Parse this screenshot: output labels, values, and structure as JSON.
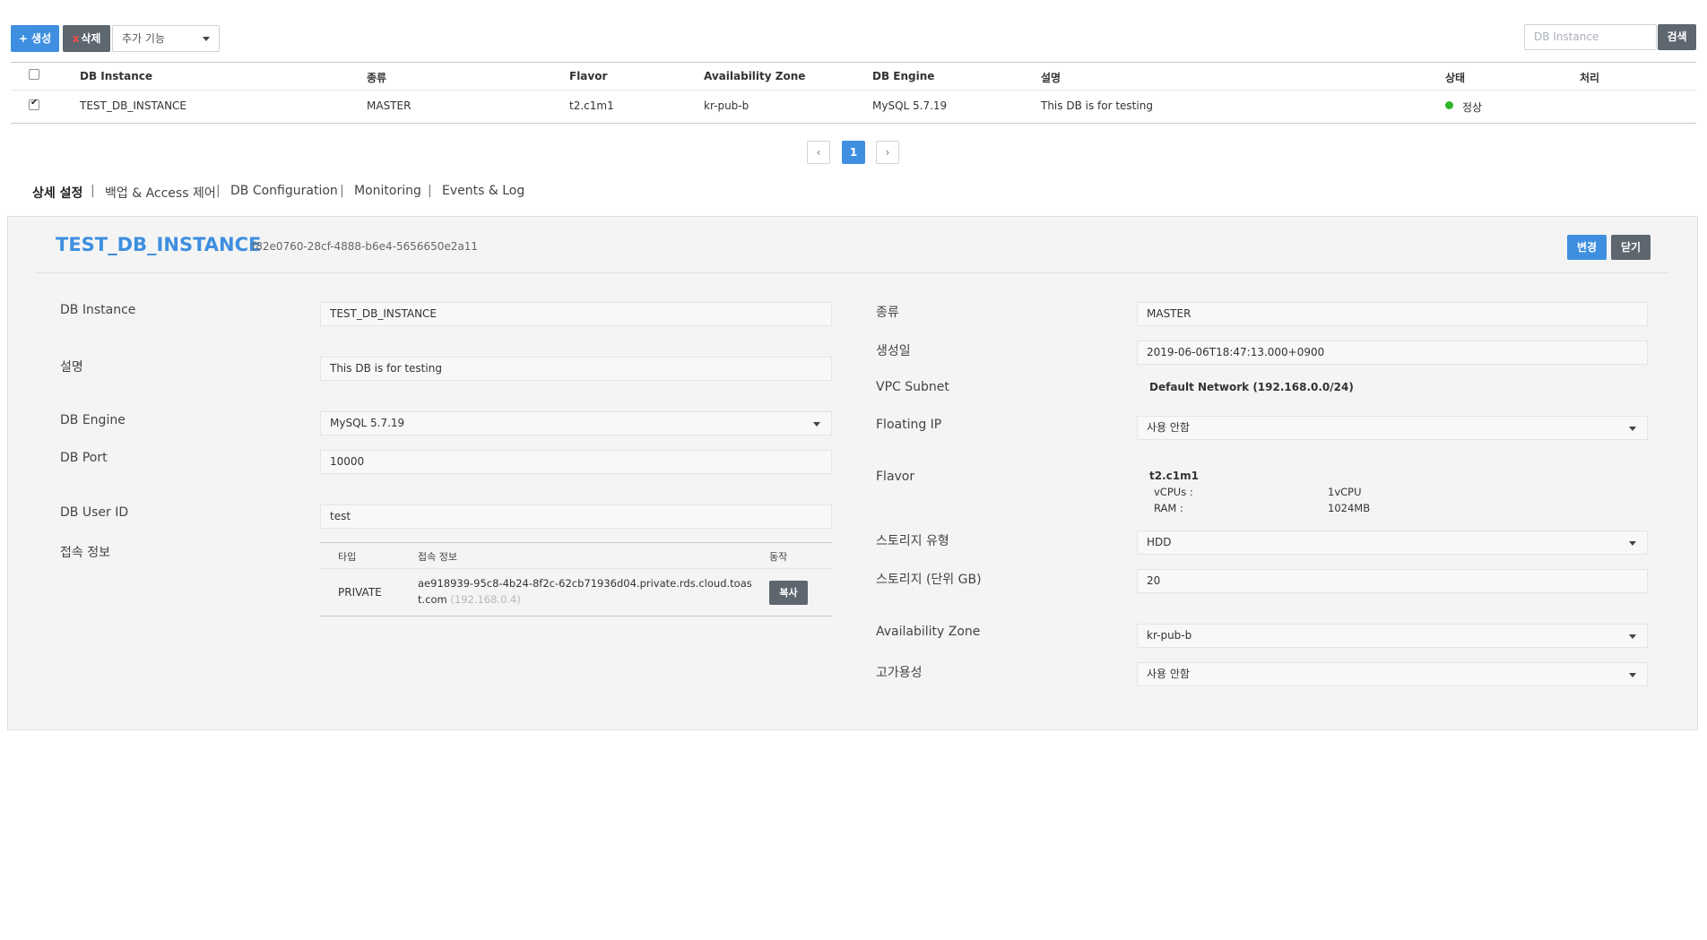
{
  "toolbar": {
    "create_label": "+ 생성",
    "delete_x": "x",
    "delete_label": "삭제",
    "more_select": "추가 기능",
    "search_placeholder": "DB Instance",
    "search_button": "검색"
  },
  "table": {
    "headers": [
      "DB Instance",
      "종류",
      "Flavor",
      "Availability Zone",
      "DB Engine",
      "설명",
      "상태",
      "처리"
    ],
    "rows": [
      {
        "checked": true,
        "instance": "TEST_DB_INSTANCE",
        "type": "MASTER",
        "flavor": "t2.c1m1",
        "zone": "kr-pub-b",
        "engine": "MySQL 5.7.19",
        "description": "This DB is for testing",
        "status": "정상",
        "action": ""
      }
    ]
  },
  "pagination": {
    "prev": "‹",
    "current": "1",
    "next": "›"
  },
  "tabs": [
    "상세 설정",
    "백업 & Access 제어",
    "DB Configuration",
    "Monitoring",
    "Events & Log"
  ],
  "tab_separator": "|",
  "detail": {
    "title": "TEST_DB_INSTANCE",
    "uuid": "f82e0760-28cf-4888-b6e4-5656650e2a11",
    "change_button": "변경",
    "close_button": "닫기",
    "left": {
      "instance_label": "DB Instance",
      "instance_value": "TEST_DB_INSTANCE",
      "desc_label": "설명",
      "desc_value": "This DB is for testing",
      "engine_label": "DB Engine",
      "engine_value": "MySQL 5.7.19",
      "port_label": "DB Port",
      "port_value": "10000",
      "user_label": "DB User ID",
      "user_value": "test",
      "conn_label": "접속 정보",
      "conn": {
        "headers": [
          "타입",
          "접속 정보",
          "동작"
        ],
        "type": "PRIVATE",
        "host_line1": "ae918939-95c8-4b24-8f2c-62cb71936d04.private.rds.cloud.toas",
        "host_line2": "t.com",
        "ip": "(192.168.0.4)",
        "copy_button": "복사"
      }
    },
    "right": {
      "kind_label": "종류",
      "kind_value": "MASTER",
      "created_label": "생성일",
      "created_value": "2019-06-06T18:47:13.000+0900",
      "subnet_label": "VPC Subnet",
      "subnet_value": "Default Network (192.168.0.0/24)",
      "fip_label": "Floating IP",
      "fip_value": "사용 안함",
      "flavor_label": "Flavor",
      "flavor_name": "t2.c1m1",
      "vcpu_label": "vCPUs :",
      "vcpu_value": "1vCPU",
      "ram_label": "RAM :",
      "ram_value": "1024MB",
      "storage_type_label": "스토리지 유형",
      "storage_type_value": "HDD",
      "storage_size_label": "스토리지 (단위 GB)",
      "storage_size_value": "20",
      "az_label": "Availability Zone",
      "az_value": "kr-pub-b",
      "ha_label": "고가용성",
      "ha_value": "사용 안함"
    }
  },
  "colors": {
    "accent": "#3e8fe0",
    "dark_button": "#5e6670",
    "status_ok": "#2fb62a",
    "panel_bg": "#f4f4f4"
  }
}
